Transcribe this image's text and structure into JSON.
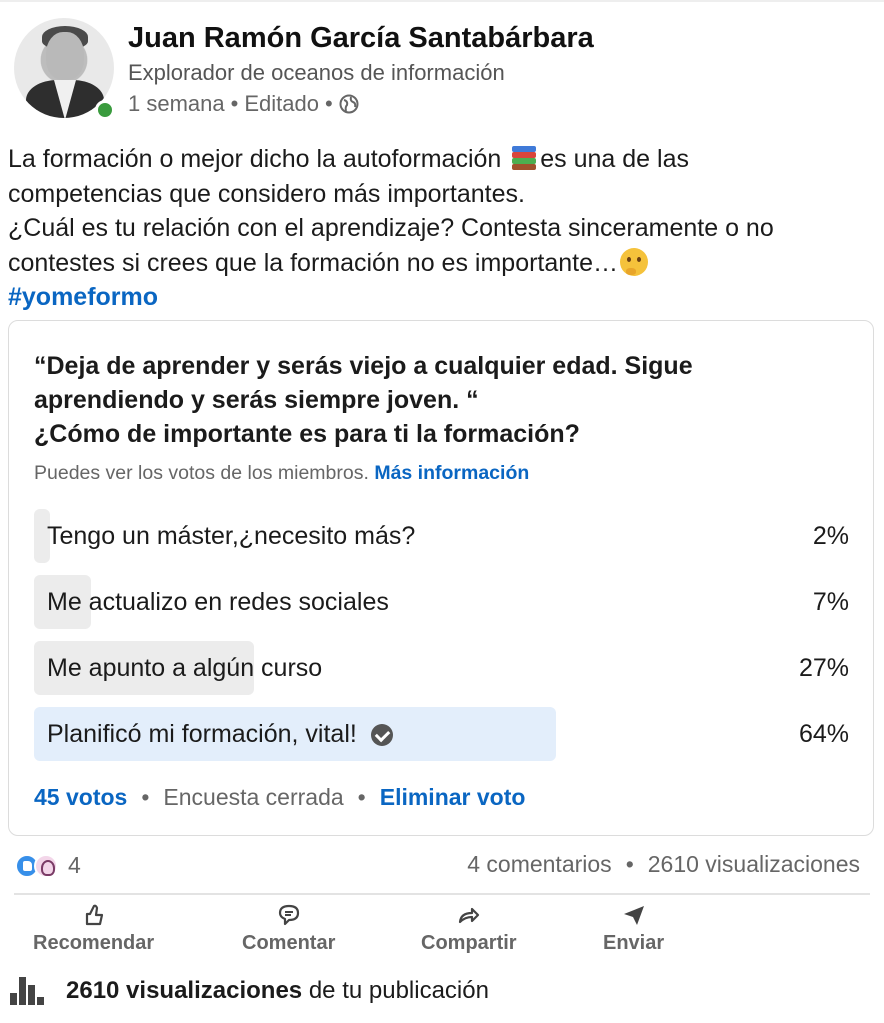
{
  "author": {
    "name": "Juan Ramón García Santabárbara",
    "headline": "Explorador de oceanos de información",
    "time": "1 semana",
    "edited": "Editado",
    "dot": "•",
    "online_color": "#3a9b3e"
  },
  "post": {
    "line1_a": "La formación o mejor dicho la autoformación",
    "line1_b": "es una de las",
    "line2": "competencias que considero más importantes.",
    "line3": "¿Cuál es tu relación con el aprendizaje? Contesta sinceramente o no",
    "line4": "contestes si crees que la formación no es importante…",
    "hashtag": "#yomeformo",
    "emojis": [
      "books-emoji",
      "thinking-face-emoji"
    ]
  },
  "poll": {
    "question_line1": "“Deja de aprender y serás viejo a cualquier edad. Sigue",
    "question_line2": "aprendiendo y serás siempre joven. “",
    "question_line3": "¿Cómo de importante es para ti la formación?",
    "note": "Puedes ver los votos de los miembros.",
    "note_link": "Más información",
    "options": [
      {
        "label": "Tengo un máster,¿necesito más?",
        "percent_label": "2%",
        "percent": 2,
        "selected": false
      },
      {
        "label": "Me actualizo en redes sociales",
        "percent_label": "7%",
        "percent": 7,
        "selected": false
      },
      {
        "label": "Me apunto a algún curso",
        "percent_label": "27%",
        "percent": 27,
        "selected": false
      },
      {
        "label": "Planificó mi formación, vital!",
        "percent_label": "64%",
        "percent": 64,
        "selected": true
      }
    ],
    "votes": "45 votos",
    "status": "Encuesta cerrada",
    "remove_vote": "Eliminar voto",
    "dot": "•"
  },
  "social": {
    "reaction_count": "4",
    "comments": "4 comentarios",
    "views": "2610 visualizaciones",
    "dot": "•"
  },
  "actions": [
    {
      "label": "Recomendar",
      "icon": "thumbs-up-icon"
    },
    {
      "label": "Comentar",
      "icon": "comment-icon"
    },
    {
      "label": "Compartir",
      "icon": "share-arrow-icon"
    },
    {
      "label": "Enviar",
      "icon": "send-icon"
    }
  ],
  "analytics": {
    "views_bold": "2610 visualizaciones",
    "suffix": "de tu publicación"
  },
  "colors": {
    "link": "#0a66c2",
    "bar_fill": "#ececec",
    "bar_selected": "#e3eefb"
  }
}
